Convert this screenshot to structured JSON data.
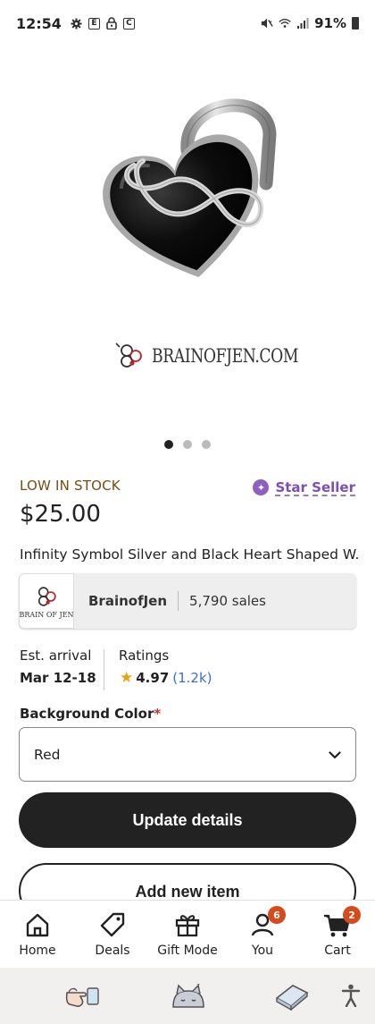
{
  "status_bar": {
    "time": "12:54",
    "battery": "91%",
    "icons": [
      "gear-icon",
      "e-box-icon",
      "lock-icon",
      "c-box-icon",
      "mute-icon",
      "wifi-icon",
      "signal-icon",
      "battery-icon"
    ]
  },
  "product": {
    "image_caption": "BRAINOFJEN.COM",
    "image_count": 3,
    "active_image": 1,
    "stock_status": "LOW IN STOCK",
    "star_seller_label": "Star Seller",
    "price": "$25.00",
    "title": "Infinity Symbol Silver and Black Heart Shaped W..."
  },
  "shop": {
    "logo_text": "BRAIN OF JEN",
    "name": "BrainofJen",
    "sales": "5,790 sales"
  },
  "delivery": {
    "arrival_label": "Est. arrival",
    "arrival_date": "Mar 12-18"
  },
  "ratings": {
    "label": "Ratings",
    "value": "4.97",
    "count": "(1.2k)"
  },
  "variation": {
    "label": "Background Color",
    "required_mark": "*",
    "selected": "Red"
  },
  "actions": {
    "update_label": "Update details",
    "add_label": "Add new item"
  },
  "bottom_nav": {
    "items": [
      {
        "label": "Home",
        "icon": "home-icon"
      },
      {
        "label": "Deals",
        "icon": "tag-icon"
      },
      {
        "label": "Gift Mode",
        "icon": "gift-icon"
      },
      {
        "label": "You",
        "icon": "user-icon",
        "badge": "6"
      },
      {
        "label": "Cart",
        "icon": "cart-icon",
        "badge": "2"
      }
    ]
  },
  "colors": {
    "stock": "#7a4b10",
    "star_seller": "#7b4fb8",
    "link": "#3b6fd1",
    "badge": "#d64b1c",
    "primary_button": "#222222"
  }
}
